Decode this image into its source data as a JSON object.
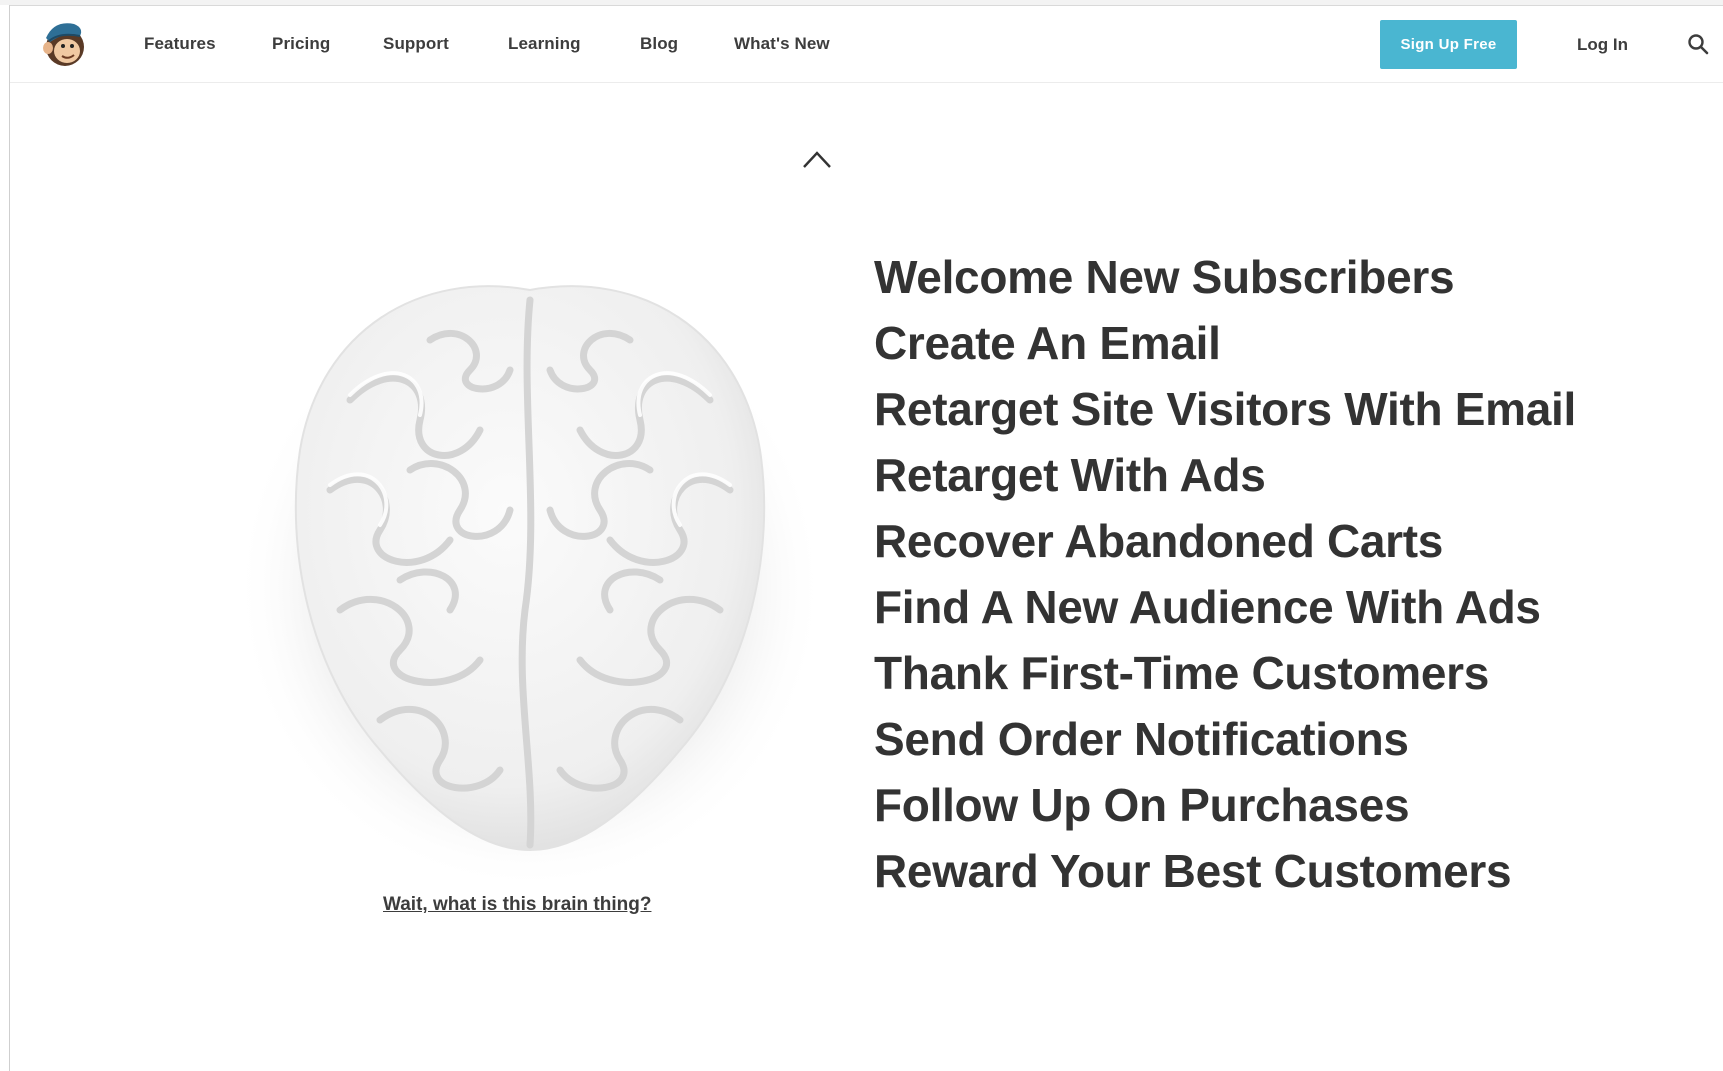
{
  "brand": {
    "logo_icon": "chimp-logo-icon",
    "accent": "#4ab6d1"
  },
  "nav": {
    "items": [
      {
        "label": "Features"
      },
      {
        "label": "Pricing"
      },
      {
        "label": "Support"
      },
      {
        "label": "Learning"
      },
      {
        "label": "Blog"
      },
      {
        "label": "What's New"
      }
    ],
    "signup_label": "Sign Up Free",
    "login_label": "Log In",
    "search_icon": "search-icon"
  },
  "main": {
    "up_icon": "chevron-up-icon",
    "brain_image": "brain-illustration",
    "brain_link": "Wait, what is this brain thing?",
    "use_cases": [
      "Welcome New Subscribers",
      "Create An Email",
      "Retarget Site Visitors With Email",
      "Retarget With Ads",
      "Recover Abandoned Carts",
      "Find A New Audience With Ads",
      "Thank First-Time Customers",
      "Send Order Notifications",
      "Follow Up On Purchases",
      "Reward Your Best Customers"
    ]
  }
}
